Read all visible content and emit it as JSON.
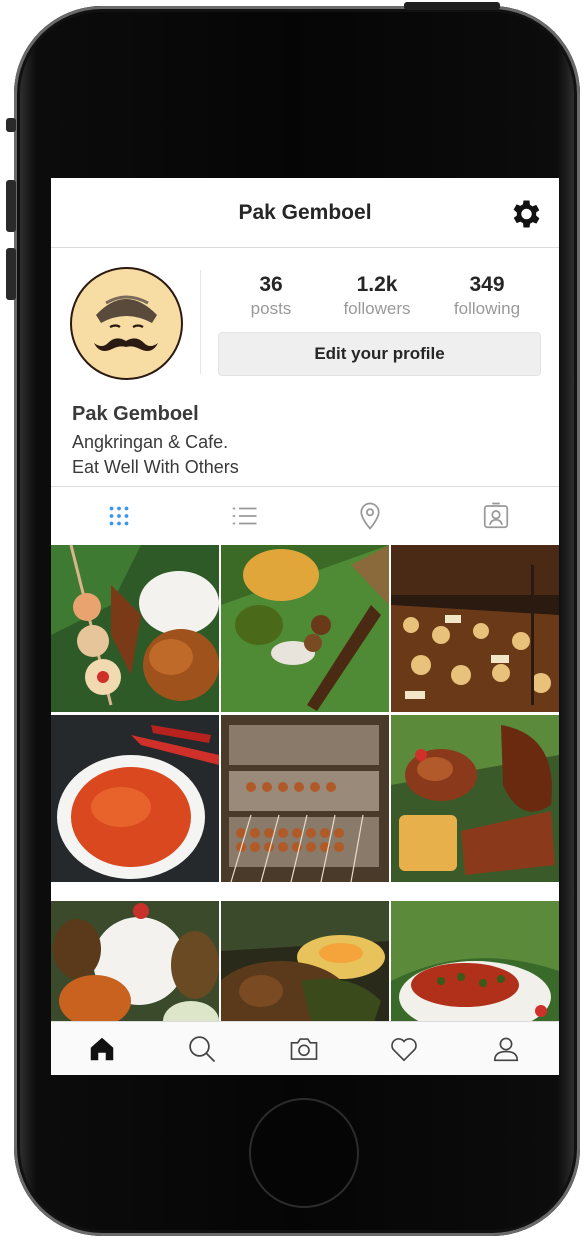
{
  "header": {
    "title": "Pak Gemboel",
    "settings_icon": "gear-icon"
  },
  "profile": {
    "avatar_icon": "mustache-man-avatar",
    "stats": [
      {
        "value": "36",
        "label": "posts"
      },
      {
        "value": "1.2k",
        "label": "followers"
      },
      {
        "value": "349",
        "label": "following"
      }
    ],
    "edit_label": "Edit your profile"
  },
  "bio": {
    "name": "Pak Gemboel",
    "line1": "Angkringan & Cafe.",
    "line2": "Eat Well With Others"
  },
  "tabs": [
    {
      "icon": "grid-icon",
      "active": true
    },
    {
      "icon": "list-icon",
      "active": false
    },
    {
      "icon": "location-pin-icon",
      "active": false
    },
    {
      "icon": "tagged-person-icon",
      "active": false
    }
  ],
  "photos": [
    "satay-with-rice-and-fried-chicken",
    "satay-skewers-on-banana-leaf",
    "angkringan-food-stall-buffet",
    "bowl-of-sambal-chili-sauce",
    "trays-of-meatball-skewers",
    "fried-chicken-with-tofu-and-tempeh",
    "rice-with-side-dishes",
    "curry-with-boiled-egg",
    "rice-with-shredded-chili-topping"
  ],
  "bottom_nav": [
    {
      "icon": "home-icon",
      "active": true
    },
    {
      "icon": "search-icon",
      "active": false
    },
    {
      "icon": "camera-icon",
      "active": false
    },
    {
      "icon": "heart-icon",
      "active": false
    },
    {
      "icon": "profile-icon",
      "active": false
    }
  ],
  "colors": {
    "accent": "#3897f0",
    "text": "#262626",
    "muted": "#999999"
  }
}
